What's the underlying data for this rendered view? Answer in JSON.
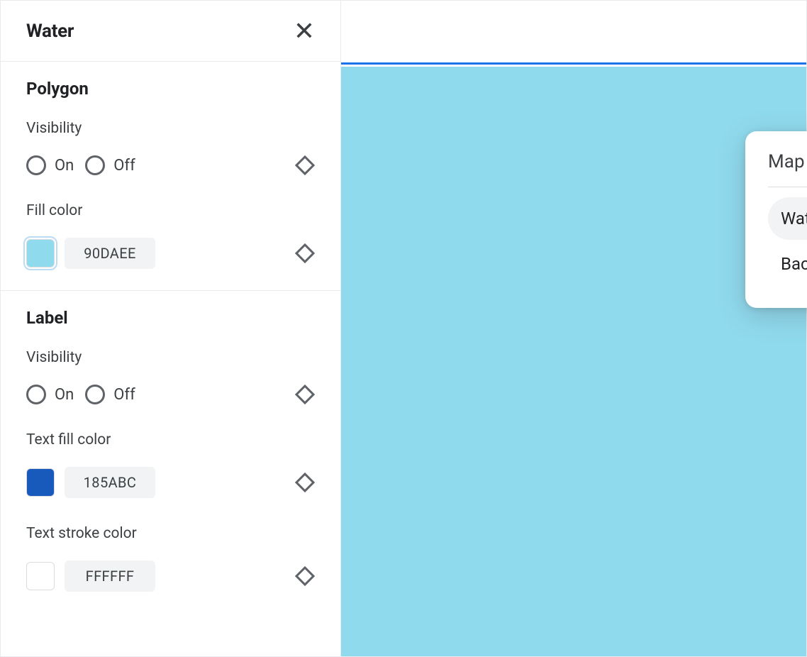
{
  "sidebar": {
    "title": "Water",
    "sections": [
      {
        "heading": "Polygon",
        "visibility": {
          "label": "Visibility",
          "on": "On",
          "off": "Off"
        },
        "fill": {
          "label": "Fill color",
          "hex": "90DAEE",
          "swatch": "#90DAEE"
        }
      },
      {
        "heading": "Label",
        "visibility": {
          "label": "Visibility",
          "on": "On",
          "off": "Off"
        },
        "text_fill": {
          "label": "Text fill color",
          "hex": "185ABC",
          "swatch": "#185ABC"
        },
        "text_stroke": {
          "label": "Text stroke color",
          "hex": "FFFFFF",
          "swatch": "#FFFFFF"
        }
      }
    ]
  },
  "canvas": {
    "water_color": "#90DAEE"
  },
  "popover": {
    "title": "Map features",
    "items": [
      {
        "label": "Water",
        "selected": true
      },
      {
        "label": "Background",
        "selected": false
      }
    ]
  }
}
